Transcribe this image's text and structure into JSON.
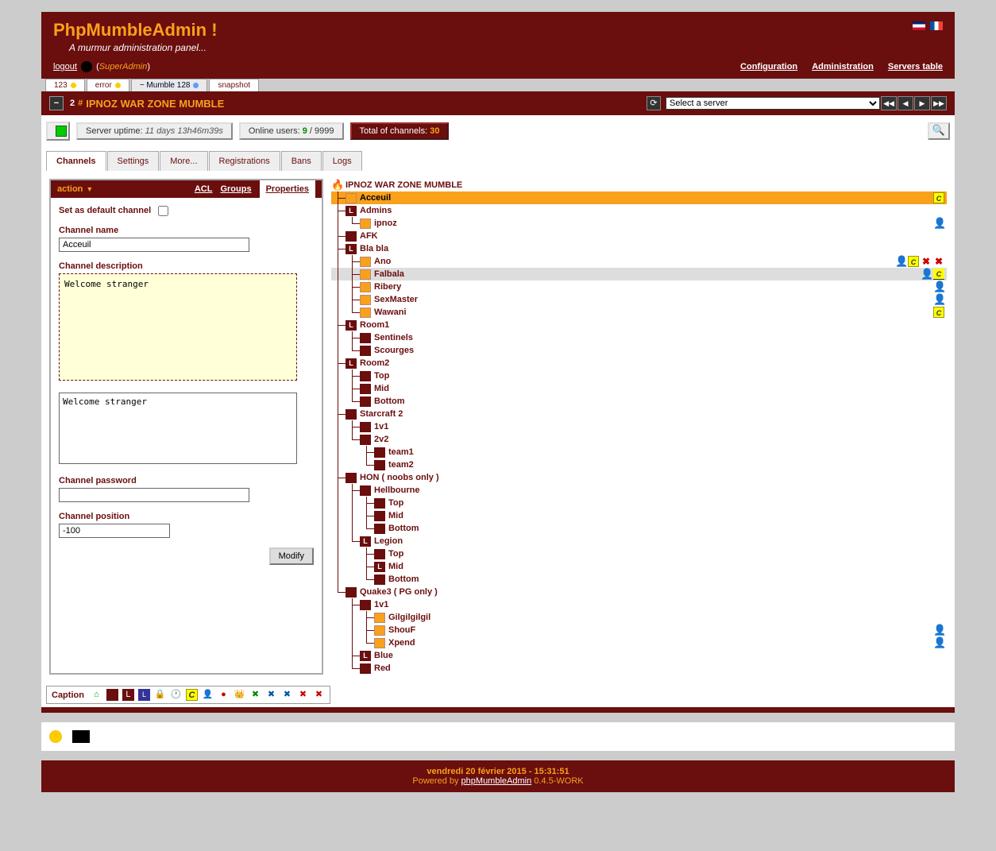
{
  "header": {
    "title": "PhpMumbleAdmin !",
    "subtitle": "A murmur administration panel...",
    "logout": "logout",
    "role": "SuperAdmin",
    "links": {
      "config": "Configuration",
      "admin": "Administration",
      "servers": "Servers table"
    }
  },
  "server_tabs": [
    {
      "label": "123"
    },
    {
      "label": "error"
    },
    {
      "label": "− Mumble 128",
      "active": true
    },
    {
      "label": "snapshot"
    }
  ],
  "titlebar": {
    "collapse": "−",
    "num": "2",
    "hash": "#",
    "name": "IPNOZ WAR ZONE MUMBLE",
    "select_placeholder": "Select a server"
  },
  "stats": {
    "uptime_label": "Server uptime:",
    "uptime_val": "11 days 13h46m39s",
    "online_label": "Online users:",
    "online_val": "9",
    "online_max": "/ 9999",
    "channels_label": "Total of channels:",
    "channels_val": "30"
  },
  "tabs": [
    "Channels",
    "Settings",
    "More...",
    "Registrations",
    "Bans",
    "Logs"
  ],
  "action": {
    "label": "action",
    "subtabs": [
      "ACL",
      "Groups",
      "Properties"
    ]
  },
  "form": {
    "default_label": "Set as default channel",
    "name_label": "Channel name",
    "name_val": "Acceuil",
    "desc_label": "Channel description",
    "desc_val": "Welcome stranger",
    "desc2_val": "Welcome stranger",
    "pw_label": "Channel password",
    "pos_label": "Channel position",
    "pos_val": "-100",
    "modify": "Modify"
  },
  "tree": [
    {
      "d": 0,
      "t": "root",
      "label": "IPNOZ WAR ZONE MUMBLE"
    },
    {
      "d": 1,
      "t": "tee",
      "sq": "or",
      "label": "Acceuil",
      "sel": true,
      "icons": [
        "c"
      ]
    },
    {
      "d": 1,
      "t": "tee",
      "sq": "L",
      "label": "Admins"
    },
    {
      "d": 2,
      "t": "end",
      "p": [
        "line"
      ],
      "sq": "or",
      "label": "ipnoz",
      "icons": [
        "user"
      ]
    },
    {
      "d": 1,
      "t": "tee",
      "sq": "dr",
      "label": "AFK"
    },
    {
      "d": 1,
      "t": "tee",
      "sq": "L",
      "label": "Bla bla"
    },
    {
      "d": 2,
      "t": "tee",
      "p": [
        "line"
      ],
      "sq": "or",
      "label": "Ano",
      "icons": [
        "user",
        "c",
        "mute",
        "deaf"
      ]
    },
    {
      "d": 2,
      "t": "tee",
      "p": [
        "line"
      ],
      "sq": "or",
      "label": "Falbala",
      "hov": true,
      "icons": [
        "user",
        "cu"
      ]
    },
    {
      "d": 2,
      "t": "tee",
      "p": [
        "line"
      ],
      "sq": "or",
      "label": "Ribery",
      "icons": [
        "user"
      ]
    },
    {
      "d": 2,
      "t": "tee",
      "p": [
        "line"
      ],
      "sq": "or",
      "label": "SexMaster",
      "icons": [
        "user"
      ]
    },
    {
      "d": 2,
      "t": "end",
      "p": [
        "line"
      ],
      "sq": "or",
      "label": "Wawani",
      "icons": [
        "c"
      ]
    },
    {
      "d": 1,
      "t": "tee",
      "sq": "L",
      "label": "Room1"
    },
    {
      "d": 2,
      "t": "tee",
      "p": [
        "line"
      ],
      "sq": "dr",
      "label": "Sentinels"
    },
    {
      "d": 2,
      "t": "end",
      "p": [
        "line"
      ],
      "sq": "dr",
      "label": "Scourges"
    },
    {
      "d": 1,
      "t": "tee",
      "sq": "L",
      "label": "Room2"
    },
    {
      "d": 2,
      "t": "tee",
      "p": [
        "line"
      ],
      "sq": "dr",
      "label": "Top"
    },
    {
      "d": 2,
      "t": "tee",
      "p": [
        "line"
      ],
      "sq": "dr",
      "label": "Mid"
    },
    {
      "d": 2,
      "t": "end",
      "p": [
        "line"
      ],
      "sq": "dr",
      "label": "Bottom"
    },
    {
      "d": 1,
      "t": "tee",
      "sq": "dr",
      "label": "Starcraft 2"
    },
    {
      "d": 2,
      "t": "tee",
      "p": [
        "line"
      ],
      "sq": "dr",
      "label": "1v1"
    },
    {
      "d": 2,
      "t": "end",
      "p": [
        "line"
      ],
      "sq": "dr",
      "label": "2v2"
    },
    {
      "d": 3,
      "t": "tee",
      "p": [
        "line",
        "blank"
      ],
      "sq": "dr",
      "label": "team1"
    },
    {
      "d": 3,
      "t": "end",
      "p": [
        "line",
        "blank"
      ],
      "sq": "dr",
      "label": "team2"
    },
    {
      "d": 1,
      "t": "tee",
      "sq": "dr",
      "label": "HON ( noobs only )"
    },
    {
      "d": 2,
      "t": "tee",
      "p": [
        "line"
      ],
      "sq": "dr",
      "label": "Hellbourne"
    },
    {
      "d": 3,
      "t": "tee",
      "p": [
        "line",
        "line"
      ],
      "sq": "dr",
      "label": "Top"
    },
    {
      "d": 3,
      "t": "tee",
      "p": [
        "line",
        "line"
      ],
      "sq": "dr",
      "label": "Mid"
    },
    {
      "d": 3,
      "t": "end",
      "p": [
        "line",
        "line"
      ],
      "sq": "dr",
      "label": "Bottom"
    },
    {
      "d": 2,
      "t": "end",
      "p": [
        "line"
      ],
      "sq": "L",
      "label": "Legion"
    },
    {
      "d": 3,
      "t": "tee",
      "p": [
        "line",
        "blank"
      ],
      "sq": "dr",
      "label": "Top"
    },
    {
      "d": 3,
      "t": "tee",
      "p": [
        "line",
        "blank"
      ],
      "sq": "L",
      "label": "Mid"
    },
    {
      "d": 3,
      "t": "end",
      "p": [
        "line",
        "blank"
      ],
      "sq": "dr",
      "label": "Bottom"
    },
    {
      "d": 1,
      "t": "end",
      "sq": "dr",
      "label": "Quake3 ( PG only )"
    },
    {
      "d": 2,
      "t": "tee",
      "p": [
        "blank"
      ],
      "sq": "dr",
      "label": "1v1"
    },
    {
      "d": 3,
      "t": "tee",
      "p": [
        "blank",
        "line"
      ],
      "sq": "or",
      "label": "Gilgilgilgil"
    },
    {
      "d": 3,
      "t": "tee",
      "p": [
        "blank",
        "line"
      ],
      "sq": "or",
      "label": "ShouF",
      "icons": [
        "user"
      ]
    },
    {
      "d": 3,
      "t": "end",
      "p": [
        "blank",
        "line"
      ],
      "sq": "or",
      "label": "Xpend",
      "icons": [
        "user"
      ]
    },
    {
      "d": 2,
      "t": "tee",
      "p": [
        "blank"
      ],
      "sq": "L",
      "label": "Blue"
    },
    {
      "d": 2,
      "t": "end",
      "p": [
        "blank"
      ],
      "sq": "dr",
      "label": "Red"
    }
  ],
  "caption": "Caption",
  "footer": {
    "date": "vendredi 20 février 2015 - 15:31:51",
    "powered": "Powered by ",
    "link": "phpMumbleAdmin",
    "version": " 0.4.5-WORK"
  }
}
